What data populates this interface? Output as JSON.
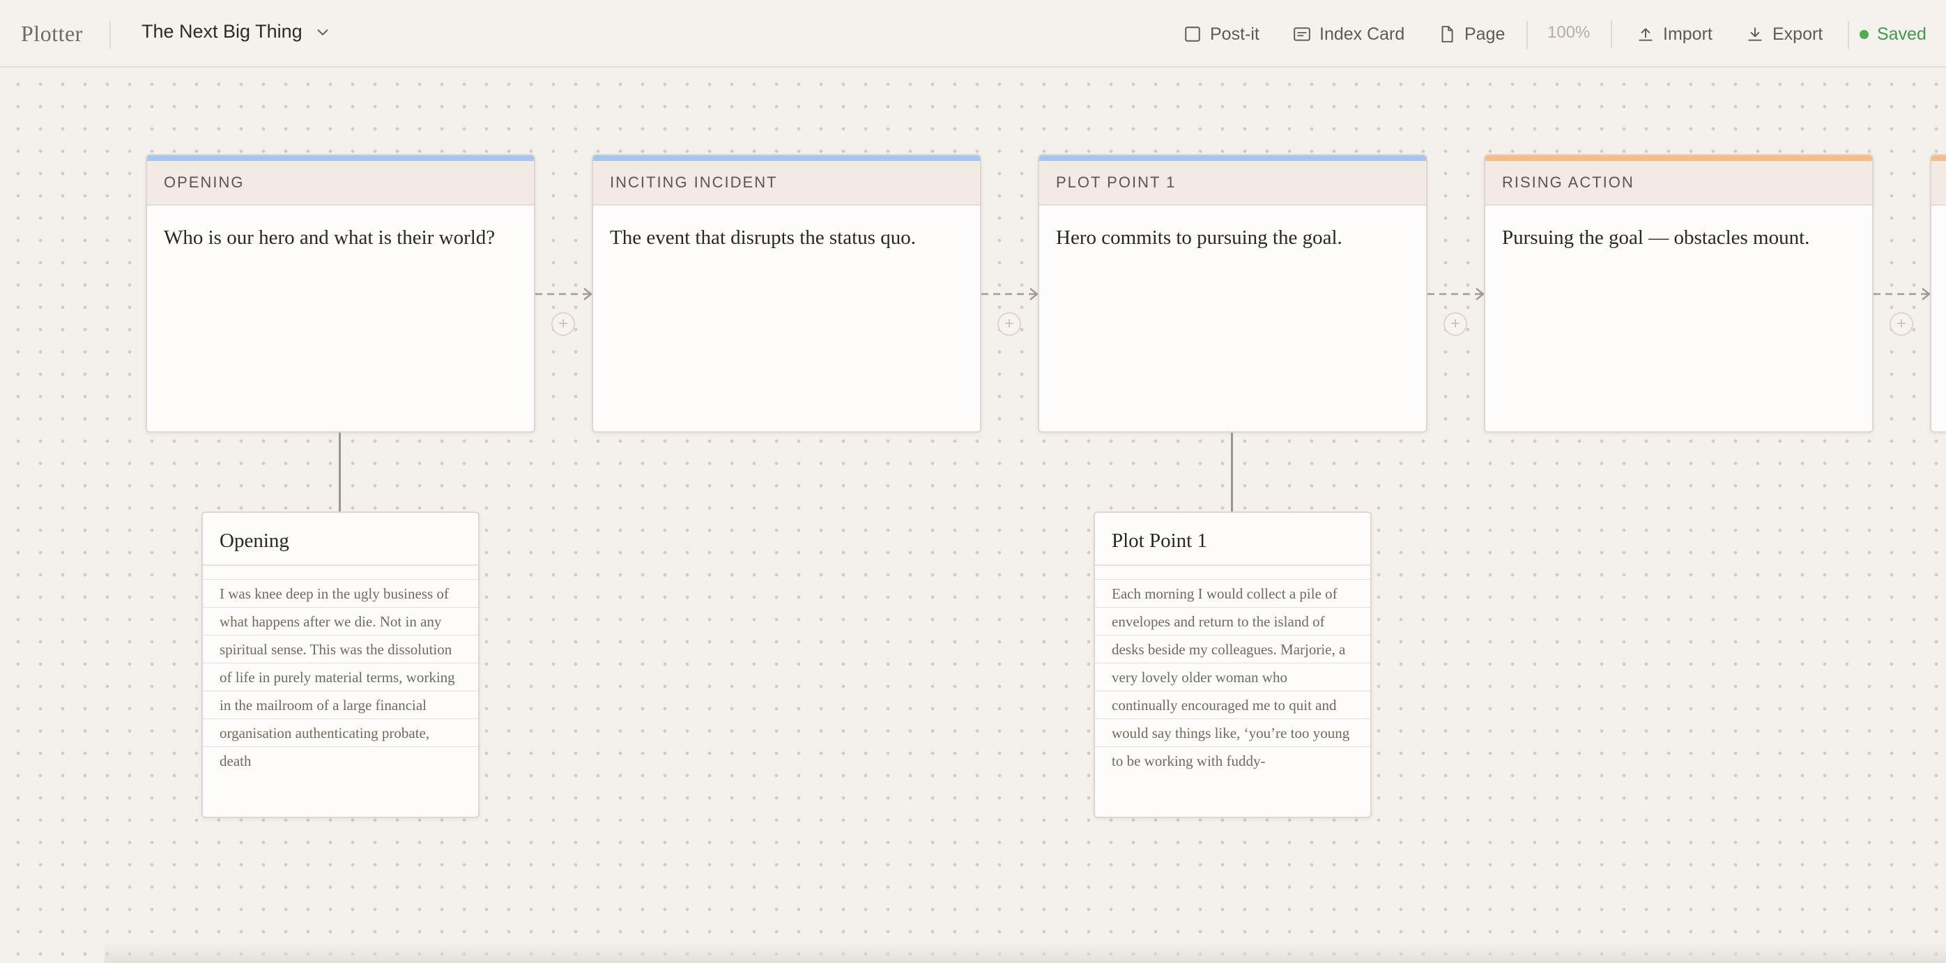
{
  "app": {
    "brand": "Plotter"
  },
  "document": {
    "title": "The Next Big Thing"
  },
  "toolbar": {
    "postit": "Post-it",
    "index_card": "Index Card",
    "page": "Page",
    "zoom": "100%",
    "import": "Import",
    "export": "Export",
    "status": "Saved"
  },
  "colors": {
    "blue_accent": "#a3c7f2",
    "orange_accent": "#f6be86",
    "saved_green": "#4caf50"
  },
  "beats": [
    {
      "label": "OPENING",
      "text": "Who is our hero and what is their world?",
      "accent": "#a3c7f2"
    },
    {
      "label": "INCITING INCIDENT",
      "text": "The event that disrupts the status quo.",
      "accent": "#a3c7f2"
    },
    {
      "label": "PLOT POINT 1",
      "text": "Hero commits to pursuing the goal.",
      "accent": "#a3c7f2"
    },
    {
      "label": "RISING ACTION",
      "text": "Pursuing the goal — obstacles mount.",
      "accent": "#f6be86"
    }
  ],
  "scenes": [
    {
      "title": "Opening",
      "text": "I was knee deep in the ugly business of what happens after we die. Not in any spiritual sense. This was the dissolution of life in purely material terms, working in the mailroom of a large financial organisation authenticating probate, death"
    },
    {
      "title": "Plot Point 1",
      "text": "Each morning I would collect a pile of envelopes and return to the island of desks beside my colleagues. Marjorie, a very lovely older woman who continually encouraged me to quit and would say things like, ‘you’re too young to be working with fuddy-"
    }
  ],
  "add_label": "+"
}
